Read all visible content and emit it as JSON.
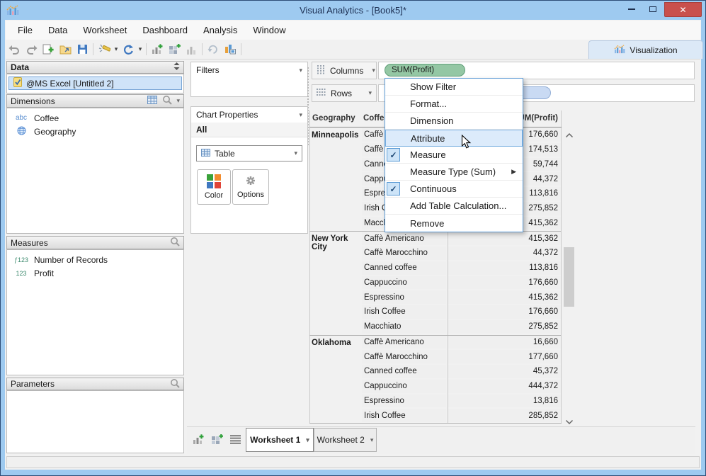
{
  "titlebar": {
    "title": "Visual Analytics - [Book5]*"
  },
  "menubar": {
    "items": [
      "File",
      "Data",
      "Worksheet",
      "Dashboard",
      "Analysis",
      "Window"
    ]
  },
  "toolbar": {
    "visualization": "Visualization"
  },
  "icons": {
    "caret": "▾",
    "check": "✓",
    "submenu": "▶",
    "close": "✕",
    "sort": "⇕"
  },
  "data_panel": {
    "header": "Data",
    "source": {
      "label": "@MS Excel [Untitled 2]"
    },
    "dimensions": {
      "header": "Dimensions",
      "items": [
        {
          "icon": "abc",
          "label": "Coffee"
        },
        {
          "icon": "globe",
          "label": "Geography"
        }
      ]
    },
    "measures": {
      "header": "Measures",
      "items": [
        {
          "icon": "ƒ123",
          "label": "Number of Records"
        },
        {
          "icon": "123",
          "label": "Profit"
        }
      ]
    },
    "parameters": {
      "header": "Parameters"
    }
  },
  "cards": {
    "filters": {
      "header": "Filters"
    },
    "chart_properties": {
      "header": "Chart Properties",
      "scope": "All",
      "type_select": "Table",
      "color": "Color",
      "options": "Options"
    }
  },
  "shelves": {
    "columns": {
      "label": "Columns",
      "pill": "SUM(Profit)"
    },
    "rows": {
      "label": "Rows"
    }
  },
  "context_menu": {
    "items": [
      {
        "label": "Show Filter"
      },
      {
        "label": "Format..."
      },
      {
        "label": "Dimension"
      },
      {
        "label": "Attribute",
        "highlighted": true
      },
      {
        "label": "Measure",
        "checked": true
      },
      {
        "label": "Measure Type (Sum)",
        "submenu": true
      },
      {
        "label": "Continuous",
        "checked": true
      },
      {
        "label": "Add Table Calculation..."
      },
      {
        "label": "Remove"
      }
    ]
  },
  "table": {
    "headers": [
      "Geography",
      "Coffee",
      "SUM(Profit)"
    ],
    "groups": [
      {
        "geography": "Minneapolis",
        "rows": [
          [
            "Caffè Americano",
            "176,660"
          ],
          [
            "Caffè Marocchino",
            "174,513"
          ],
          [
            "Canned coffee",
            "59,744"
          ],
          [
            "Cappuccino",
            "44,372"
          ],
          [
            "Espressino",
            "113,816"
          ],
          [
            "Irish Coffee",
            "275,852"
          ],
          [
            "Macchiato",
            "415,362"
          ]
        ]
      },
      {
        "geography": "New York City",
        "rows": [
          [
            "Caffè Americano",
            "415,362"
          ],
          [
            "Caffè Marocchino",
            "44,372"
          ],
          [
            "Canned coffee",
            "113,816"
          ],
          [
            "Cappuccino",
            "176,660"
          ],
          [
            "Espressino",
            "415,362"
          ],
          [
            "Irish Coffee",
            "176,660"
          ],
          [
            "Macchiato",
            "275,852"
          ]
        ]
      },
      {
        "geography": "Oklahoma",
        "rows": [
          [
            "Caffè Americano",
            "16,660"
          ],
          [
            "Caffè Marocchino",
            "177,660"
          ],
          [
            "Canned coffee",
            "45,372"
          ],
          [
            "Cappuccino",
            "444,372"
          ],
          [
            "Espressino",
            "13,816"
          ],
          [
            "Irish Coffee",
            "285,852"
          ]
        ]
      }
    ]
  },
  "sheet_tabs": {
    "tabs": [
      {
        "label": "Worksheet 1",
        "active": true
      },
      {
        "label": "Worksheet 2",
        "active": false
      }
    ]
  },
  "colors": {
    "pill_green": "#94c7a4",
    "pill_blue": "#c9daf3",
    "menu_highlight": "#dcebfb",
    "titlebar": "#9ecaf0",
    "close_red": "#c9504c",
    "accent_blue": "#5b9bd5"
  }
}
